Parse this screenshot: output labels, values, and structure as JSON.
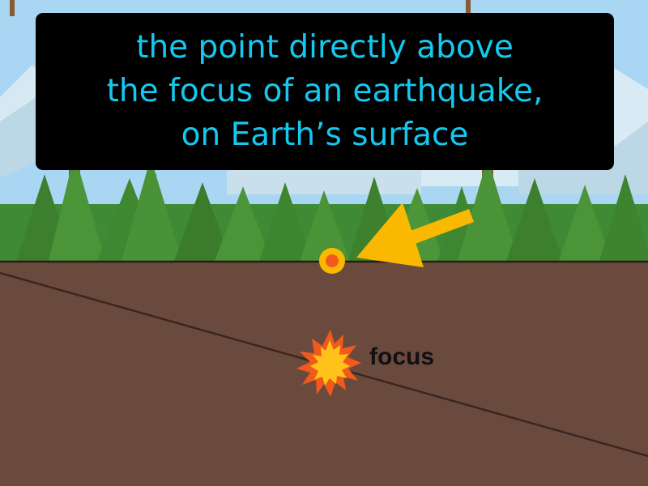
{
  "definition": {
    "lines": [
      "the point directly above",
      "the focus of an earthquake,",
      "on Earth’s surface"
    ]
  },
  "labels": {
    "focus": "focus"
  },
  "icons": {
    "epicenter_marker": "epicenter-dot-icon",
    "pointer_arrow": "arrow-icon",
    "focus_burst": "explosion-burst-icon"
  },
  "colors": {
    "sky": "#a9d6f2",
    "ground": "#6b4a3e",
    "definition_text": "#14c8ee",
    "definition_bg": "#000000",
    "arrow": "#fbb800",
    "epicenter_ring": "#fbb800",
    "epicenter_core": "#f05a1e",
    "burst_outer": "#f25a1c",
    "burst_inner": "#ffc21a"
  }
}
